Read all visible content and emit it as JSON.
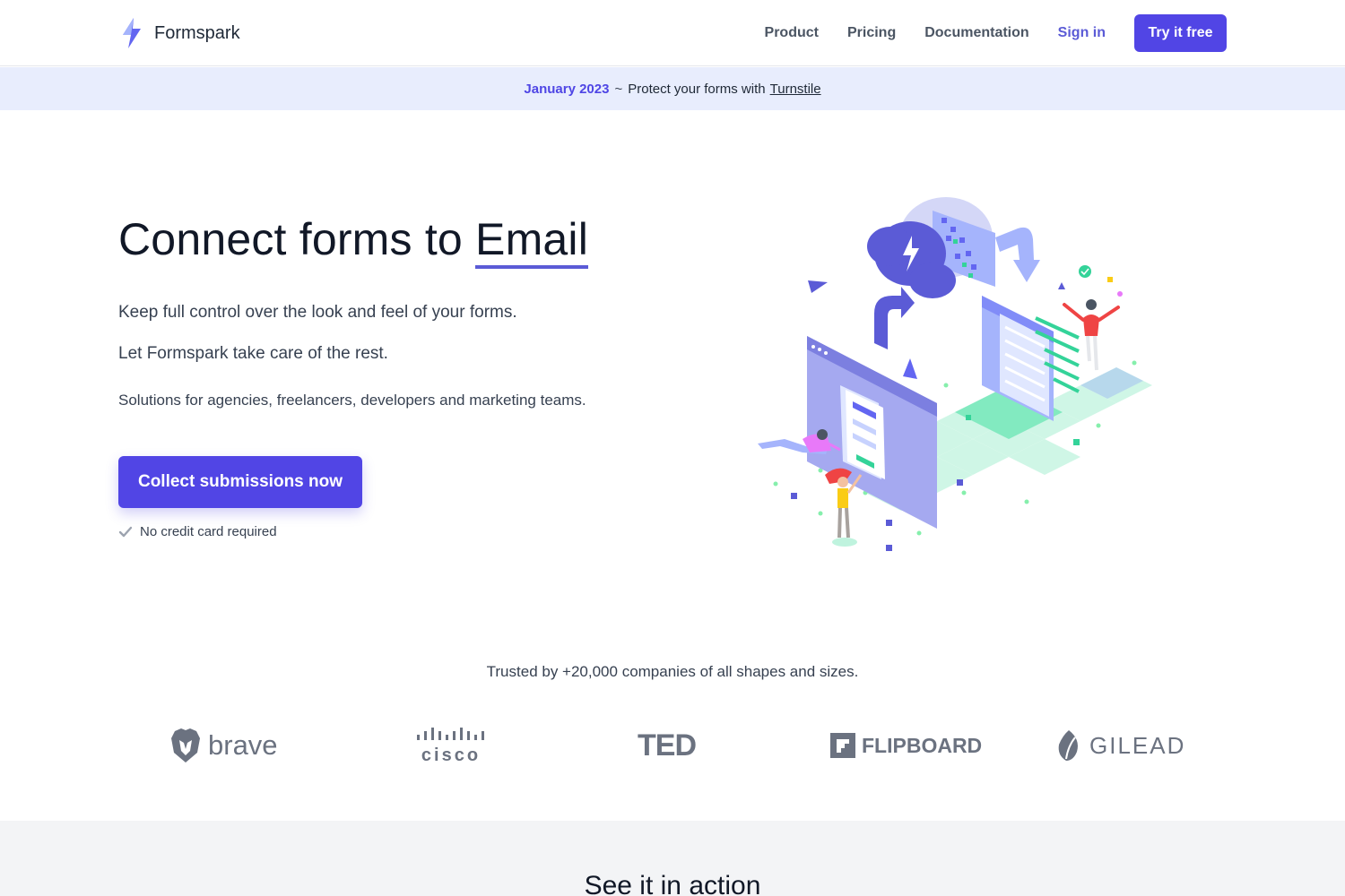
{
  "header": {
    "brand": "Formspark",
    "nav": [
      "Product",
      "Pricing",
      "Documentation"
    ],
    "signin": "Sign in",
    "cta": "Try it free"
  },
  "banner": {
    "date": "January 2023",
    "separator": "~",
    "message": "Protect your forms with",
    "link": "Turnstile"
  },
  "hero": {
    "title_prefix": "Connect forms to",
    "title_highlight": "Email",
    "line1": "Keep full control over the look and feel of your forms.",
    "line2": "Let Formspark take care of the rest.",
    "line3": "Solutions for agencies, freelancers, developers and marketing teams.",
    "button": "Collect submissions now",
    "note": "No credit card required"
  },
  "trusted": {
    "text": "Trusted by +20,000 companies of all shapes and sizes.",
    "logos": [
      "brave",
      "cisco",
      "TED",
      "FLIPBOARD",
      "GILEAD"
    ]
  },
  "section": {
    "title": "See it in action"
  },
  "colors": {
    "accent": "#5145e5",
    "banner_bg": "#e8edfd",
    "text_dark": "#111827",
    "muted": "#6b7280",
    "section_bg": "#f3f4f6"
  }
}
